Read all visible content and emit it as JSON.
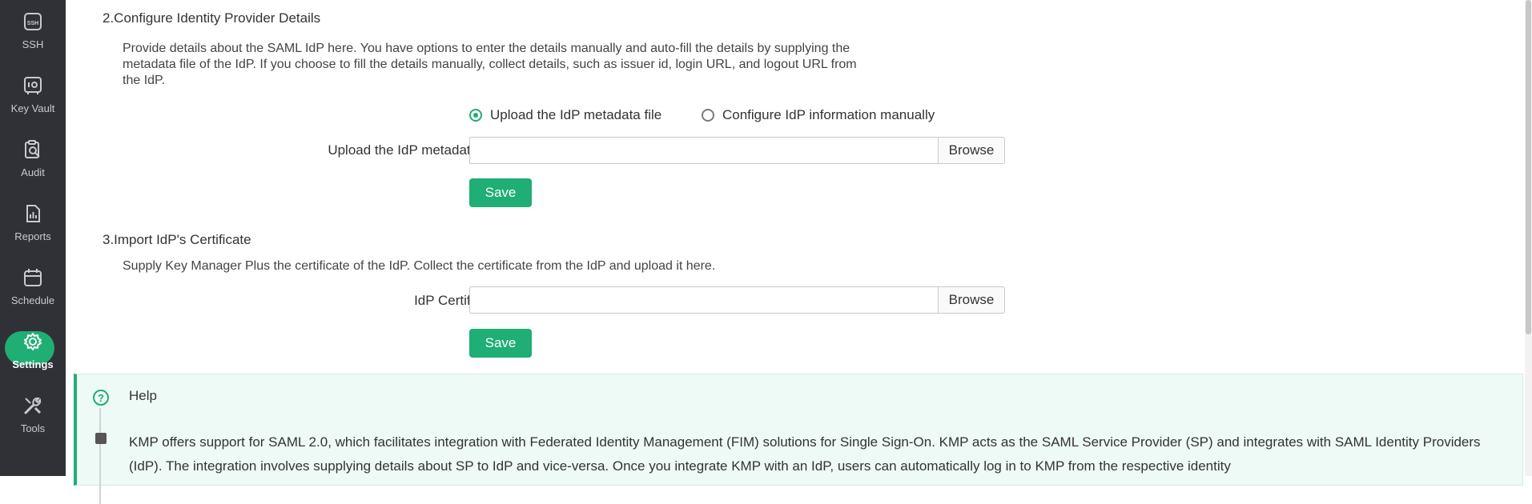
{
  "sidebar": {
    "items": [
      {
        "label": "SSH",
        "icon": "ssh-icon"
      },
      {
        "label": "Key Vault",
        "icon": "key-vault-icon"
      },
      {
        "label": "Audit",
        "icon": "audit-icon"
      },
      {
        "label": "Reports",
        "icon": "reports-icon"
      },
      {
        "label": "Schedule",
        "icon": "calendar-icon"
      },
      {
        "label": "Settings",
        "icon": "gear-icon",
        "active": true
      },
      {
        "label": "Tools",
        "icon": "tools-icon"
      }
    ]
  },
  "section2": {
    "title": "2.Configure Identity Provider Details",
    "desc_line1": "Provide details about the SAML IdP here. You have options to enter the details manually and auto-fill the details by supplying the",
    "desc_line2": "metadata file of the IdP. If you choose to fill the details manually, collect details, such as issuer id, login URL, and logout URL from",
    "desc_line3": "the IdP.",
    "radio_upload": "Upload the IdP metadata file",
    "radio_manual": "Configure IdP information manually",
    "selected_option": "Upload the IdP metadata file",
    "field_label": "Upload the IdP metadata file",
    "colon": ":",
    "field_value": "",
    "browse_label": "Browse",
    "save_label": "Save"
  },
  "section3": {
    "title": "3.Import IdP's Certificate",
    "desc": "Supply Key Manager Plus the certificate of the IdP. Collect the certificate from the IdP and upload it here.",
    "field_label": "IdP Certificate",
    "colon": ":",
    "field_value": "",
    "browse_label": "Browse",
    "save_label": "Save"
  },
  "help": {
    "title": "Help",
    "text": "KMP offers support for SAML 2.0, which facilitates integration with Federated Identity Management (FIM) solutions for Single Sign-On. KMP acts as the SAML Service Provider (SP) and integrates with SAML Identity Providers (IdP). The integration involves supplying details about SP to IdP and vice-versa. Once you integrate KMP with an IdP, users can automatically log in to KMP from the respective identity"
  },
  "colors": {
    "accent": "#1fae74",
    "sidebar_bg": "#2f3136",
    "help_bg": "#eefaf5"
  }
}
